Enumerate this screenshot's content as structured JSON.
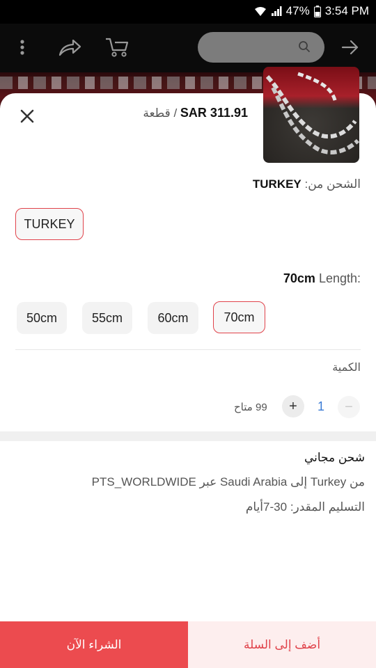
{
  "status_bar": {
    "battery": "47%",
    "time": "3:54 PM"
  },
  "toolbar": {
    "menu_icon": "more-vertical-icon",
    "share_icon": "share-icon",
    "cart_icon": "cart-icon",
    "search_icon": "search-icon",
    "forward_icon": "arrow-right-icon"
  },
  "sheet": {
    "price": "SAR 311.91",
    "price_unit": "/ قطعة",
    "ship_from_label": "الشحن من:",
    "ship_from_value": "TURKEY",
    "origin_options": [
      "TURKEY"
    ],
    "origin_selected": "TURKEY",
    "length_label": "Length:",
    "length_value": "70cm",
    "length_options": [
      "50cm",
      "55cm",
      "60cm",
      "70cm"
    ],
    "length_selected": "70cm",
    "quantity_label": "الكمية",
    "quantity_value": "1",
    "stock_text": "99 متاح"
  },
  "shipping": {
    "title": "شحن مجاني",
    "route": "من Turkey إلى Saudi Arabia عبر PTS_WORLDWIDE",
    "eta": "التسليم المقدر: 30-7أيام"
  },
  "actions": {
    "buy_now": "الشراء الآن",
    "add_to_cart": "أضف إلى السلة"
  },
  "colors": {
    "accent": "#ec4b4f",
    "accent_soft": "#fdeeee",
    "selected_border": "#e0424a",
    "qty_value": "#3a7bd5"
  }
}
